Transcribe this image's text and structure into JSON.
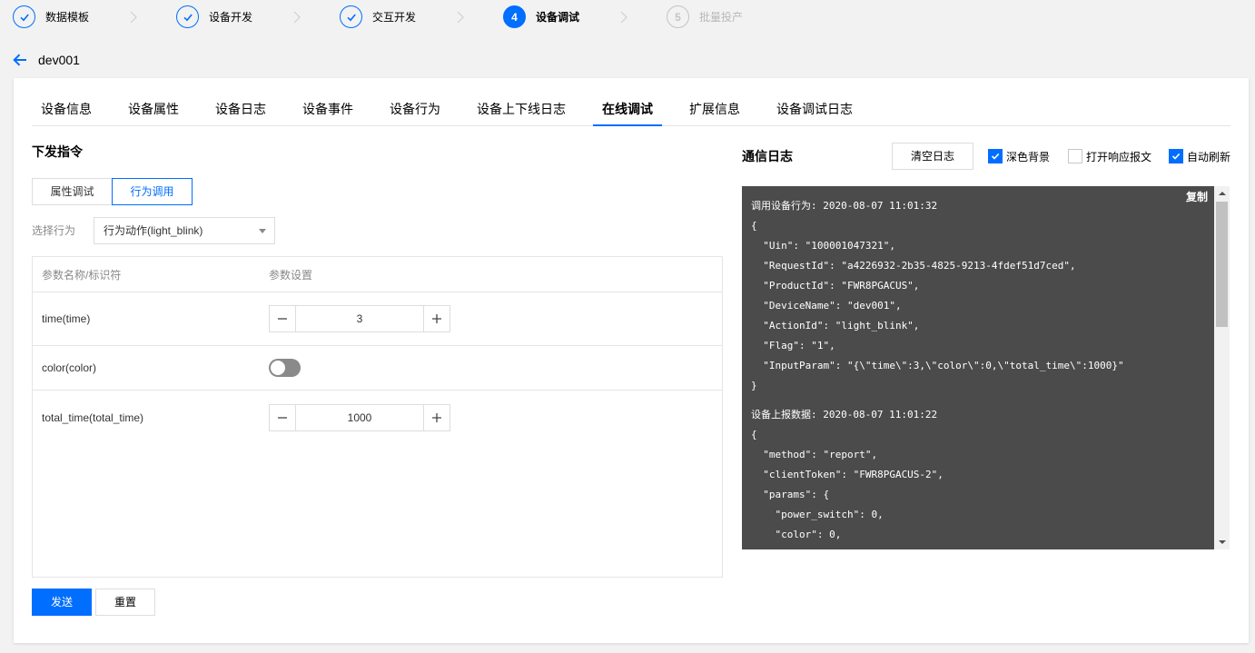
{
  "theme": {
    "accent": "#006eff",
    "log_background": "#4b4b4b"
  },
  "stepper": {
    "steps": [
      {
        "label": "数据模板",
        "completed": true,
        "current": false
      },
      {
        "label": "设备开发",
        "completed": true,
        "current": false
      },
      {
        "label": "交互开发",
        "completed": true,
        "current": false
      },
      {
        "number": "4",
        "label": "设备调试",
        "completed": false,
        "current": true
      },
      {
        "number": "5",
        "label": "批量投产",
        "completed": false,
        "current": false
      }
    ]
  },
  "header": {
    "back_icon": "arrow-left-icon",
    "title": "dev001"
  },
  "tabs": [
    {
      "label": "设备信息",
      "active": false
    },
    {
      "label": "设备属性",
      "active": false
    },
    {
      "label": "设备日志",
      "active": false
    },
    {
      "label": "设备事件",
      "active": false
    },
    {
      "label": "设备行为",
      "active": false
    },
    {
      "label": "设备上下线日志",
      "active": false
    },
    {
      "label": "在线调试",
      "active": true
    },
    {
      "label": "扩展信息",
      "active": false
    },
    {
      "label": "设备调试日志",
      "active": false
    }
  ],
  "command": {
    "title": "下发指令",
    "modes": [
      {
        "label": "属性调试",
        "active": false
      },
      {
        "label": "行为调用",
        "active": true
      }
    ],
    "action_select": {
      "label": "选择行为",
      "value": "行为动作(light_blink)"
    },
    "params_table": {
      "columns": [
        "参数名称/标识符",
        "参数设置"
      ],
      "rows": [
        {
          "name": "time(time)",
          "value": 3
        },
        {
          "name": "color(color)",
          "on": false
        },
        {
          "name": "total_time(total_time)",
          "value": 1000
        }
      ]
    },
    "send_label": "发送",
    "reset_label": "重置"
  },
  "log": {
    "title": "通信日志",
    "clear_label": "清空日志",
    "options": [
      {
        "label": "深色背景",
        "checked": true
      },
      {
        "label": "打开响应报文",
        "checked": false
      },
      {
        "label": "自动刷新",
        "checked": true
      }
    ],
    "copy_label": "复制",
    "entries": [
      {
        "header": "调用设备行为: 2020-08-07 11:01:32",
        "lines": [
          "{",
          "  \"Uin\": \"100001047321\",",
          "  \"RequestId\": \"a4226932-2b35-4825-9213-4fdef51d7ced\",",
          "  \"ProductId\": \"FWR8PGACUS\",",
          "  \"DeviceName\": \"dev001\",",
          "  \"ActionId\": \"light_blink\",",
          "  \"Flag\": \"1\",",
          "  \"InputParam\": \"{\\\"time\\\":3,\\\"color\\\":0,\\\"total_time\\\":1000}\"",
          "}"
        ]
      },
      {
        "header": "设备上报数据: 2020-08-07 11:01:22",
        "lines": [
          "{",
          "  \"method\": \"report\",",
          "  \"clientToken\": \"FWR8PGACUS-2\",",
          "  \"params\": {",
          "    \"power_switch\": 0,",
          "    \"color\": 0,"
        ]
      }
    ]
  }
}
